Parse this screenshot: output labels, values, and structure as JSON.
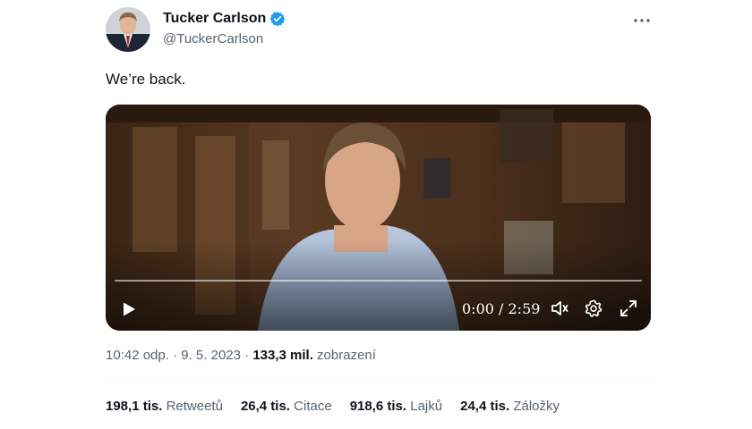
{
  "author": {
    "name": "Tucker Carlson",
    "handle": "@TuckerCarlson",
    "verified": true
  },
  "tweet": {
    "text": "We’re back."
  },
  "video": {
    "time": "0:00 / 2:59",
    "progress": 0
  },
  "meta": {
    "time": "10:42 odp.",
    "sep1": " · ",
    "date": "9. 5. 2023",
    "sep2": " · ",
    "views_count": "133,3 mil.",
    "views_label": " zobrazení"
  },
  "stats": [
    {
      "count": "198,1 tis.",
      "label": "Retweetů"
    },
    {
      "count": "26,4 tis.",
      "label": "Citace"
    },
    {
      "count": "918,6 tis.",
      "label": "Lajků"
    },
    {
      "count": "24,4 tis.",
      "label": "Záložky"
    }
  ],
  "colors": {
    "verified": "#1d9bf0",
    "secondary_text": "#536471",
    "primary_text": "#0f1419"
  }
}
